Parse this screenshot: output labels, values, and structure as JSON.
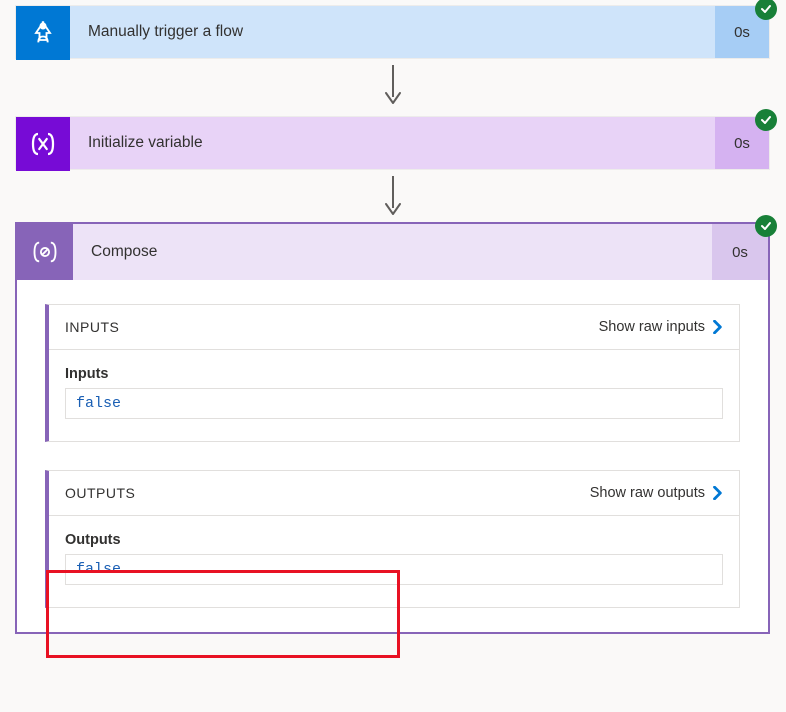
{
  "steps": {
    "trigger": {
      "title": "Manually trigger a flow",
      "duration": "0s"
    },
    "initVar": {
      "title": "Initialize variable",
      "duration": "0s"
    },
    "compose": {
      "title": "Compose",
      "duration": "0s"
    }
  },
  "compose": {
    "inputs": {
      "sectionTitle": "INPUTS",
      "showRawLabel": "Show raw inputs",
      "fieldLabel": "Inputs",
      "fieldValue": "false"
    },
    "outputs": {
      "sectionTitle": "OUTPUTS",
      "showRawLabel": "Show raw outputs",
      "fieldLabel": "Outputs",
      "fieldValue": "false"
    }
  }
}
